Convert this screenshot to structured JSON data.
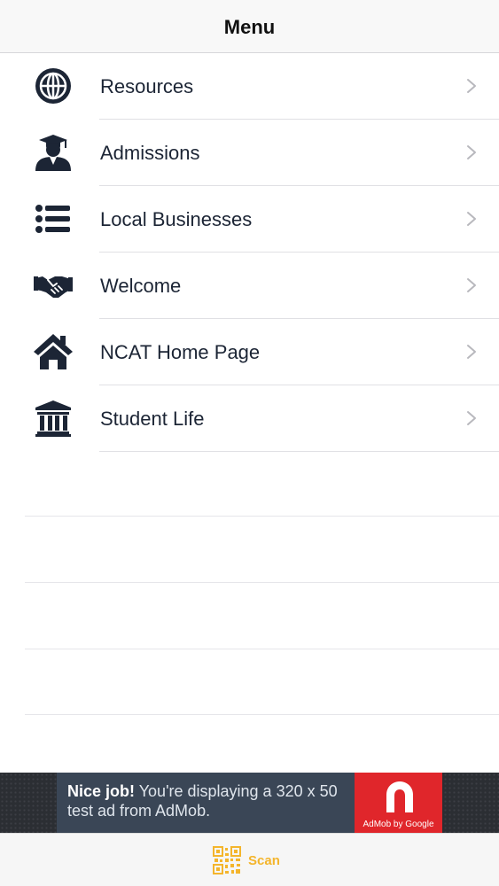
{
  "navbar": {
    "title": "Menu"
  },
  "menu": {
    "items": [
      {
        "label": "Resources",
        "icon": "globe-icon"
      },
      {
        "label": "Admissions",
        "icon": "graduate-icon"
      },
      {
        "label": "Local Businesses",
        "icon": "list-icon"
      },
      {
        "label": "Welcome",
        "icon": "handshake-icon"
      },
      {
        "label": "NCAT Home Page",
        "icon": "home-icon"
      },
      {
        "label": "Student Life",
        "icon": "institution-icon"
      }
    ]
  },
  "ad": {
    "headline": "Nice job!",
    "body": " You're displaying a 320 x 50 test ad from AdMob.",
    "logo_text": "AdMob by Google"
  },
  "tabbar": {
    "scan_label": "Scan",
    "scan_icon": "qr-code-icon"
  },
  "colors": {
    "icon": "#1c2535",
    "accent": "#f4b52c",
    "ad_red": "#e0262b"
  }
}
